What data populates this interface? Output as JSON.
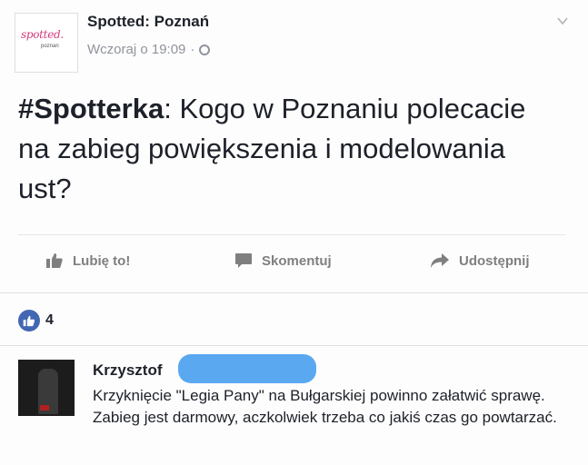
{
  "post": {
    "page_logo_text": "spotted.",
    "page_logo_sub": "poznan",
    "page_name": "Spotted: Poznań",
    "timestamp": "Wczoraj o 19:09",
    "separator": "·",
    "hashtag": "#Spotterka",
    "text": ": Kogo w Poznaniu polecacie na zabieg powiększenia i modelowania ust?"
  },
  "actions": {
    "like_label": "Lubię to!",
    "comment_label": "Skomentuj",
    "share_label": "Udostępnij"
  },
  "reactions": {
    "count": "4"
  },
  "comment": {
    "author": "Krzysztof",
    "text": "Krzyknięcie \"Legia Pany\" na Bułgarskiej powinno załatwić sprawę. Zabieg jest darmowy, aczkolwiek trzeba co jakiś czas go powtarzać."
  },
  "icons": {
    "options": "chevron-down-icon",
    "privacy": "globe-icon",
    "like": "thumbs-up-icon",
    "comment": "speech-bubble-icon",
    "share": "share-arrow-icon"
  },
  "colors": {
    "brand_blue": "#4267b2",
    "redaction": "#5aa8f0",
    "logo_pink": "#d33a7c"
  }
}
